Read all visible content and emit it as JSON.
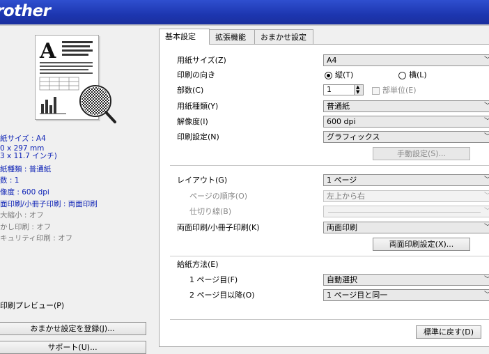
{
  "header": {
    "brand": "rother",
    "brand_color": "#1d36b0"
  },
  "left": {
    "summary": [
      {
        "text": "紙サイズ : A4",
        "style": "blue"
      },
      {
        "text": "0 x 297 mm",
        "style": "blue"
      },
      {
        "text": "3 x 11.7 インチ)",
        "style": "blue"
      },
      {
        "text": "紙種類 : 普通紙",
        "style": "blue"
      },
      {
        "text": "数 : 1",
        "style": "blue"
      },
      {
        "text": "像度 : 600 dpi",
        "style": "blue"
      },
      {
        "text": "面印刷/小冊子印刷 : 両面印刷",
        "style": "blue"
      },
      {
        "text": "大縮小 : オフ",
        "style": "gray"
      },
      {
        "text": "かし印刷 : オフ",
        "style": "gray"
      },
      {
        "text": "キュリティ印刷 : オフ",
        "style": "gray"
      }
    ],
    "print_preview_label": "印刷プレビュー(P)",
    "register_button": "おまかせ設定を登録(J)...",
    "support_button": "サポート(U)..."
  },
  "tabs": [
    {
      "label": "基本設定",
      "active": true
    },
    {
      "label": "拡張機能",
      "active": false
    },
    {
      "label": "おまかせ設定",
      "active": false
    }
  ],
  "form": {
    "paper_size": {
      "label": "用紙サイズ(Z)",
      "value": "A4"
    },
    "orientation": {
      "label": "印刷の向き",
      "portrait": "縦(T)",
      "landscape": "横(L)",
      "selected": "portrait"
    },
    "copies": {
      "label": "部数(C)",
      "value": "1",
      "collate_label": "部単位(E)"
    },
    "media_type": {
      "label": "用紙種類(Y)",
      "value": "普通紙"
    },
    "resolution": {
      "label": "解像度(I)",
      "value": "600 dpi"
    },
    "print_settings": {
      "label": "印刷設定(N)",
      "value": "グラフィックス",
      "manual_button": "手動設定(S)..."
    },
    "layout": {
      "label": "レイアウト(G)",
      "value": "1 ページ"
    },
    "page_order": {
      "label": "ページの順序(O)",
      "value": "左上から右"
    },
    "border_line": {
      "label": "仕切り線(B)",
      "value": ""
    },
    "duplex": {
      "label": "両面印刷/小冊子印刷(K)",
      "value": "両面印刷",
      "settings_button": "両面印刷設定(X)..."
    },
    "paper_source": {
      "label": "給紙方法(E)",
      "first_page": {
        "label": "1 ページ目(F)",
        "value": "自動選択"
      },
      "other_pages": {
        "label": "2 ページ目以降(O)",
        "value": "1 ページ目と同一"
      }
    },
    "default_button": "標準に戻す(D)"
  }
}
